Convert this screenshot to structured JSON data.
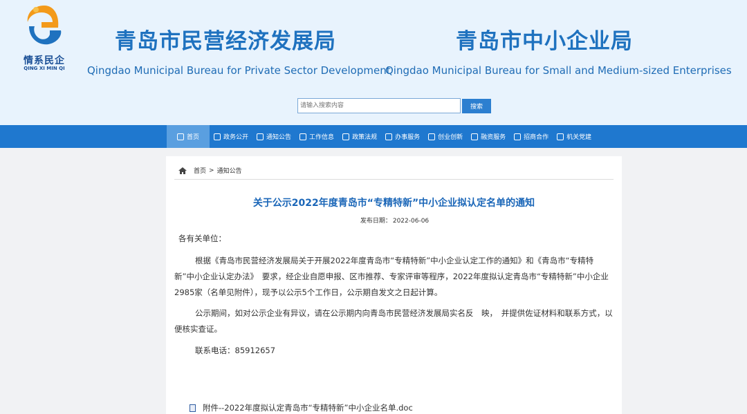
{
  "logo": {
    "cn": "情系民企",
    "en": "QING XI MIN QI"
  },
  "bureau1": {
    "cn": "青岛市民营经济发展局",
    "en": "Qingdao Municipal Bureau for Private Sector Development"
  },
  "bureau2": {
    "cn": "青岛市中小企业局",
    "en": "Qingdao Municipal Bureau for Small and Medium-sized Enterprises"
  },
  "search": {
    "placeholder": "请输入搜索内容",
    "button": "搜索"
  },
  "nav": [
    "首页",
    "政务公开",
    "通知公告",
    "工作信息",
    "政策法规",
    "办事服务",
    "创业创新",
    "融资服务",
    "招商合作",
    "机关党建"
  ],
  "breadcrumb": {
    "home": "首页",
    "sep": ">",
    "current": "通知公告"
  },
  "article": {
    "title": "关于公示2022年度青岛市“专精特新”中小企业拟认定名单的通知",
    "date_label": "发布日期：",
    "date": "2022-06-06",
    "greeting": "各有关单位：",
    "para1": "根据《青岛市民营经济发展局关于开展2022年度青岛市“专精特新”中小企业认定工作的通知》和《青岛市“专精特新”中小企业认定办法》　要求，经企业自愿申报、区市推荐、专家评审等程序，2022年度拟认定青岛市“专精特新”中小企业2985家（名单见附件），现予以公示5个工作日，公示期自发文之日起计算。",
    "para2": "公示期间，如对公示企业有异议，请在公示期内向青岛市民营经济发展局实名反　映，　并提供佐证材料和联系方式，以便核实查证。",
    "phone": "联系电话：85912657",
    "attachment": "附件--2022年度拟认定青岛市“专精特新”中小企业名单.doc"
  },
  "colors": {
    "header_bg": "#e8f3fd",
    "nav_bg": "#1f78cf",
    "title_blue": "#1a66b8",
    "active_nav": "#5a9fe0"
  }
}
